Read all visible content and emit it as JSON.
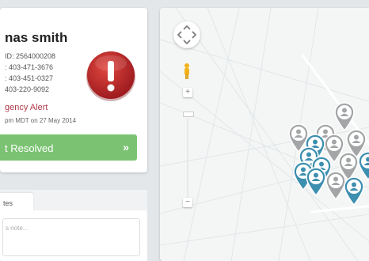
{
  "patient": {
    "name": "nas smith",
    "id_line": "ID: 2564000208",
    "phone1": ": 403-471-3676",
    "phone2": ": 403-451-0327",
    "phone3": "403-220-9092"
  },
  "alert": {
    "label": "gency Alert",
    "timestamp": "pm MDT on 27 May 2014",
    "resolve_label": "t Resolved",
    "resolve_chevron": "»",
    "icon": "exclamation-alert-icon",
    "color": "#c0272d"
  },
  "notes": {
    "tab_label": "tes",
    "placeholder": "s note..."
  },
  "map": {
    "zoom_in": "+",
    "zoom_out": "−",
    "markers": [
      {
        "kind": "gray",
        "icon": "person-marker-icon"
      },
      {
        "kind": "gray",
        "icon": "person-marker-icon"
      },
      {
        "kind": "gray",
        "icon": "person-marker-icon"
      },
      {
        "kind": "gray",
        "icon": "person-marker-icon"
      },
      {
        "kind": "gray",
        "icon": "person-marker-icon"
      },
      {
        "kind": "gray",
        "icon": "person-marker-icon"
      },
      {
        "kind": "gray",
        "icon": "person-marker-icon"
      },
      {
        "kind": "blue",
        "icon": "person-marker-icon"
      },
      {
        "kind": "blue",
        "icon": "person-marker-icon"
      },
      {
        "kind": "blue",
        "icon": "person-marker-icon"
      },
      {
        "kind": "blue",
        "icon": "person-marker-icon"
      },
      {
        "kind": "blue",
        "icon": "person-marker-icon"
      },
      {
        "kind": "blue",
        "icon": "person-marker-icon"
      },
      {
        "kind": "blue",
        "icon": "person-marker-icon"
      }
    ],
    "colors": {
      "blue": "#3d8fb0",
      "gray": "#a3a5a7",
      "accent_green": "#7bc372"
    }
  }
}
